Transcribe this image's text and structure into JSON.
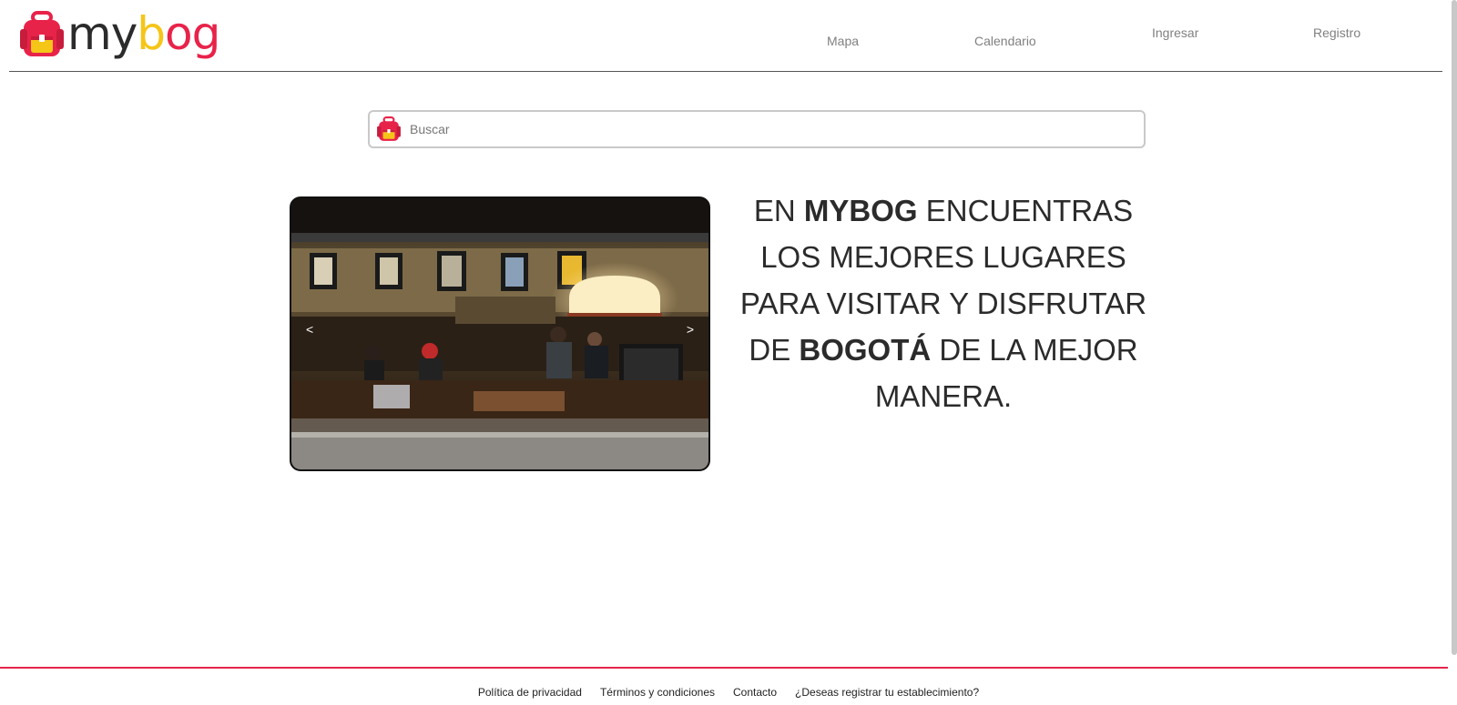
{
  "brand": {
    "logo_my": "my",
    "logo_b": "b",
    "logo_og": "og",
    "colors": {
      "red": "#e8234a",
      "yellow": "#f5c518",
      "dark": "#2b2b2b"
    }
  },
  "nav": {
    "mapa": "Mapa",
    "calendario": "Calendario",
    "ingresar": "Ingresar",
    "registro": "Registro"
  },
  "search": {
    "placeholder": "Buscar",
    "icon": "backpack-icon"
  },
  "carousel": {
    "prev": "<",
    "next": ">"
  },
  "hero": {
    "t1": "EN ",
    "t2": "MYBOG",
    "t3": " ENCUENTRAS LOS MEJORES LUGARES PARA VISITAR Y DISFRUTAR",
    "t4": "DE ",
    "t5": "BOGOTÁ",
    "t6": " DE LA MEJOR MANERA."
  },
  "footer": {
    "privacy": "Política de privacidad",
    "terms": "Términos y condiciones",
    "contact": "Contacto",
    "register_business": "¿Deseas registrar tu establecimiento?"
  }
}
